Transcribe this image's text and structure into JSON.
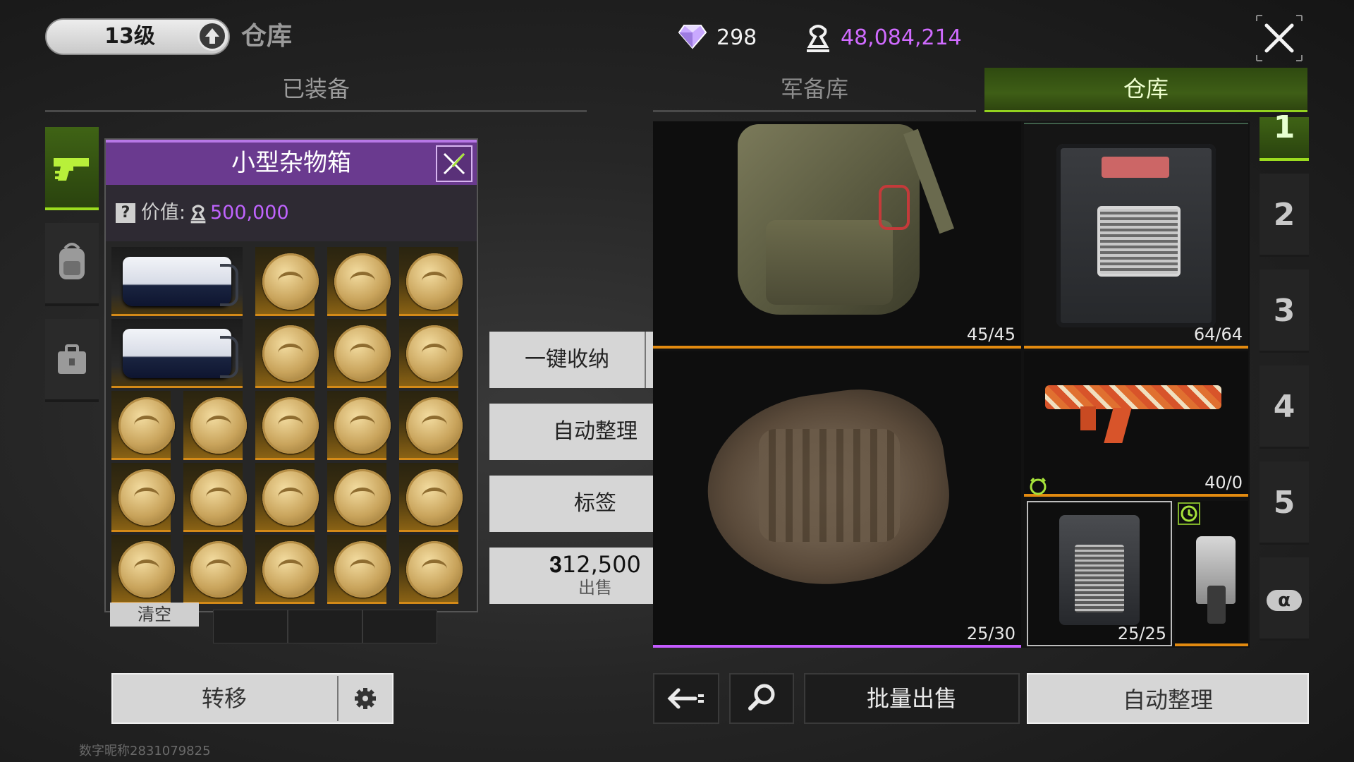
{
  "header": {
    "level": "13级",
    "title": "仓库",
    "diamonds": "298",
    "coins": "48,084,214"
  },
  "tabs": {
    "equipped": "已装备",
    "armory": "军备库",
    "warehouse": "仓库"
  },
  "popup": {
    "title": "小型杂物箱",
    "help": "?",
    "value_label": "价值:",
    "value_amount": "500,000",
    "cleanup_tab": "清空",
    "items": [
      "kit",
      "coin",
      "coin",
      "coin",
      "kit",
      "coin",
      "coin",
      "coin",
      "coin",
      "coin",
      "coin",
      "coin",
      "coin",
      "coin",
      "coin",
      "coin",
      "coin",
      "coin",
      "coin",
      "coin",
      "coin",
      "coin",
      "coin"
    ]
  },
  "actions": {
    "one_key_store": "一键收纳",
    "auto_sort": "自动整理",
    "tag": "标签",
    "sell_price": "12,500",
    "sell": "出售"
  },
  "warehouse": {
    "backpack_cap": "45/45",
    "box_cap": "64/64",
    "gun_cap": "40/0",
    "vest_cap": "25/30",
    "case_cap": "25/25",
    "pages": [
      "1",
      "2",
      "3",
      "4",
      "5",
      "α"
    ]
  },
  "bottom": {
    "transfer": "转移",
    "batch_sell": "批量出售",
    "auto_sort": "自动整理",
    "nickname": "数字昵称2831079825"
  },
  "colors": {
    "accent_green": "#93d21f",
    "popup_purple": "#6a3a8f",
    "coin_purple": "#c064ff",
    "rarity_orange": "#e28a10"
  },
  "icons": {
    "level_up": "arrow-up-circle-icon",
    "diamond": "diamond-icon",
    "currency": "coin-icon",
    "close": "close-icon",
    "gear": "gear-icon",
    "search": "search-icon",
    "back": "back-arrow-icon"
  }
}
